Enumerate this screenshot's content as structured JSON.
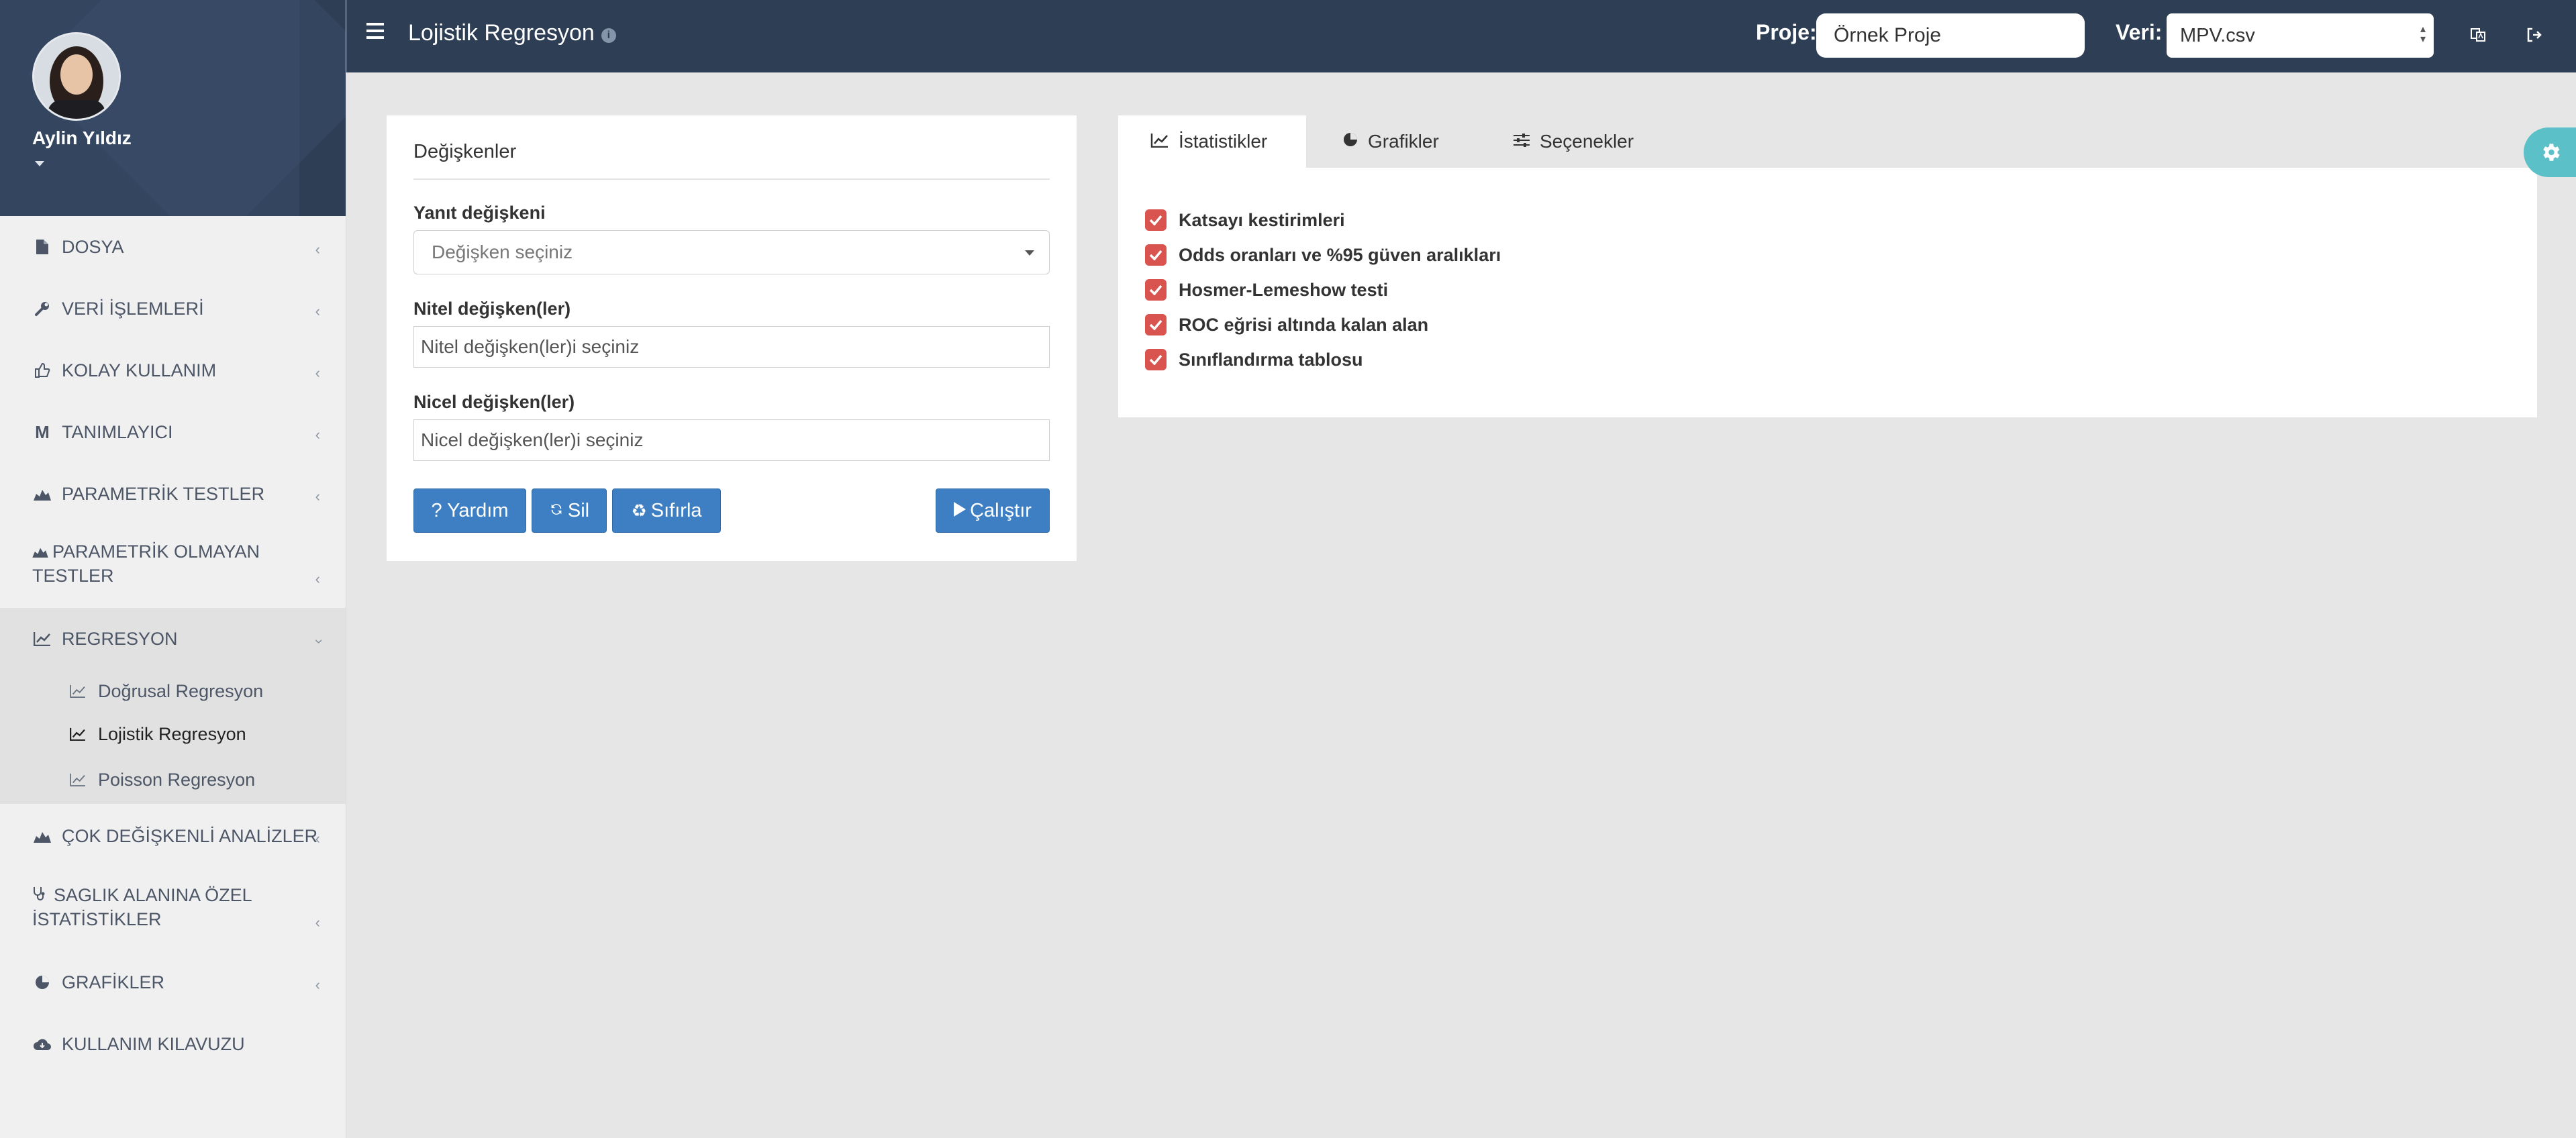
{
  "profile": {
    "name": "Aylin Yıldız"
  },
  "sidebar": {
    "items": [
      {
        "label": "DOSYA",
        "icon": "file-icon"
      },
      {
        "label": "VERİ İŞLEMLERİ",
        "icon": "wrench-icon"
      },
      {
        "label": "KOLAY KULLANIM",
        "icon": "thumbs-up-icon"
      },
      {
        "label": "TANIMLAYICI",
        "icon": "mu-icon"
      },
      {
        "label": "PARAMETRİK TESTLER",
        "icon": "stats-icon"
      },
      {
        "label": "PARAMETRİK OLMAYAN TESTLER",
        "icon": "stats-icon"
      },
      {
        "label": "REGRESYON",
        "icon": "line-chart-icon"
      },
      {
        "label": "ÇOK DEĞİŞKENLİ ANALİZLER",
        "icon": "stats-icon"
      },
      {
        "label": "SAGLIK ALANINA ÖZEL İSTATİSTİKLER",
        "icon": "stethoscope-icon"
      },
      {
        "label": "GRAFİKLER",
        "icon": "pie-chart-icon"
      },
      {
        "label": "KULLANIM KILAVUZU",
        "icon": "cloud-icon"
      }
    ],
    "regresyon_sub": [
      {
        "label": "Doğrusal Regresyon",
        "active": false
      },
      {
        "label": "Lojistik Regresyon",
        "active": true
      },
      {
        "label": "Poisson Regresyon",
        "active": false
      }
    ]
  },
  "header": {
    "title": "Lojistik Regresyon",
    "proje_label": "Proje:",
    "proje_value": "Örnek Proje",
    "veri_label": "Veri:",
    "veri_value": "MPV.csv"
  },
  "variables": {
    "title": "Değişkenler",
    "response_label": "Yanıt değişkeni",
    "response_placeholder": "Değişken seçiniz",
    "qualitative_label": "Nitel değişken(ler)",
    "qualitative_placeholder": "Nitel değişken(ler)i seçiniz",
    "quantitative_label": "Nicel değişken(ler)",
    "quantitative_placeholder": "Nicel değişken(ler)i seçiniz",
    "buttons": {
      "help": "? Yardım",
      "delete": "Sil",
      "reset": "Sıfırla",
      "run": "Çalıştır"
    }
  },
  "tabs": [
    {
      "label": "İstatistikler",
      "icon": "line-chart-icon",
      "active": true
    },
    {
      "label": "Grafikler",
      "icon": "pie-chart-icon",
      "active": false
    },
    {
      "label": "Seçenekler",
      "icon": "sliders-icon",
      "active": false
    }
  ],
  "options": [
    {
      "label": "Katsayı kestirimleri",
      "checked": true
    },
    {
      "label": "Odds oranları ve %95 güven aralıkları",
      "checked": true
    },
    {
      "label": "Hosmer-Lemeshow testi",
      "checked": true
    },
    {
      "label": "ROC eğrisi altında kalan alan",
      "checked": true
    },
    {
      "label": "Sınıflandırma tablosu",
      "checked": true
    }
  ],
  "colors": {
    "topbar": "#2d3e55",
    "primary_button": "#3e7fc4",
    "checkbox": "#d9534f",
    "settings_tab": "#5bc0c8"
  }
}
